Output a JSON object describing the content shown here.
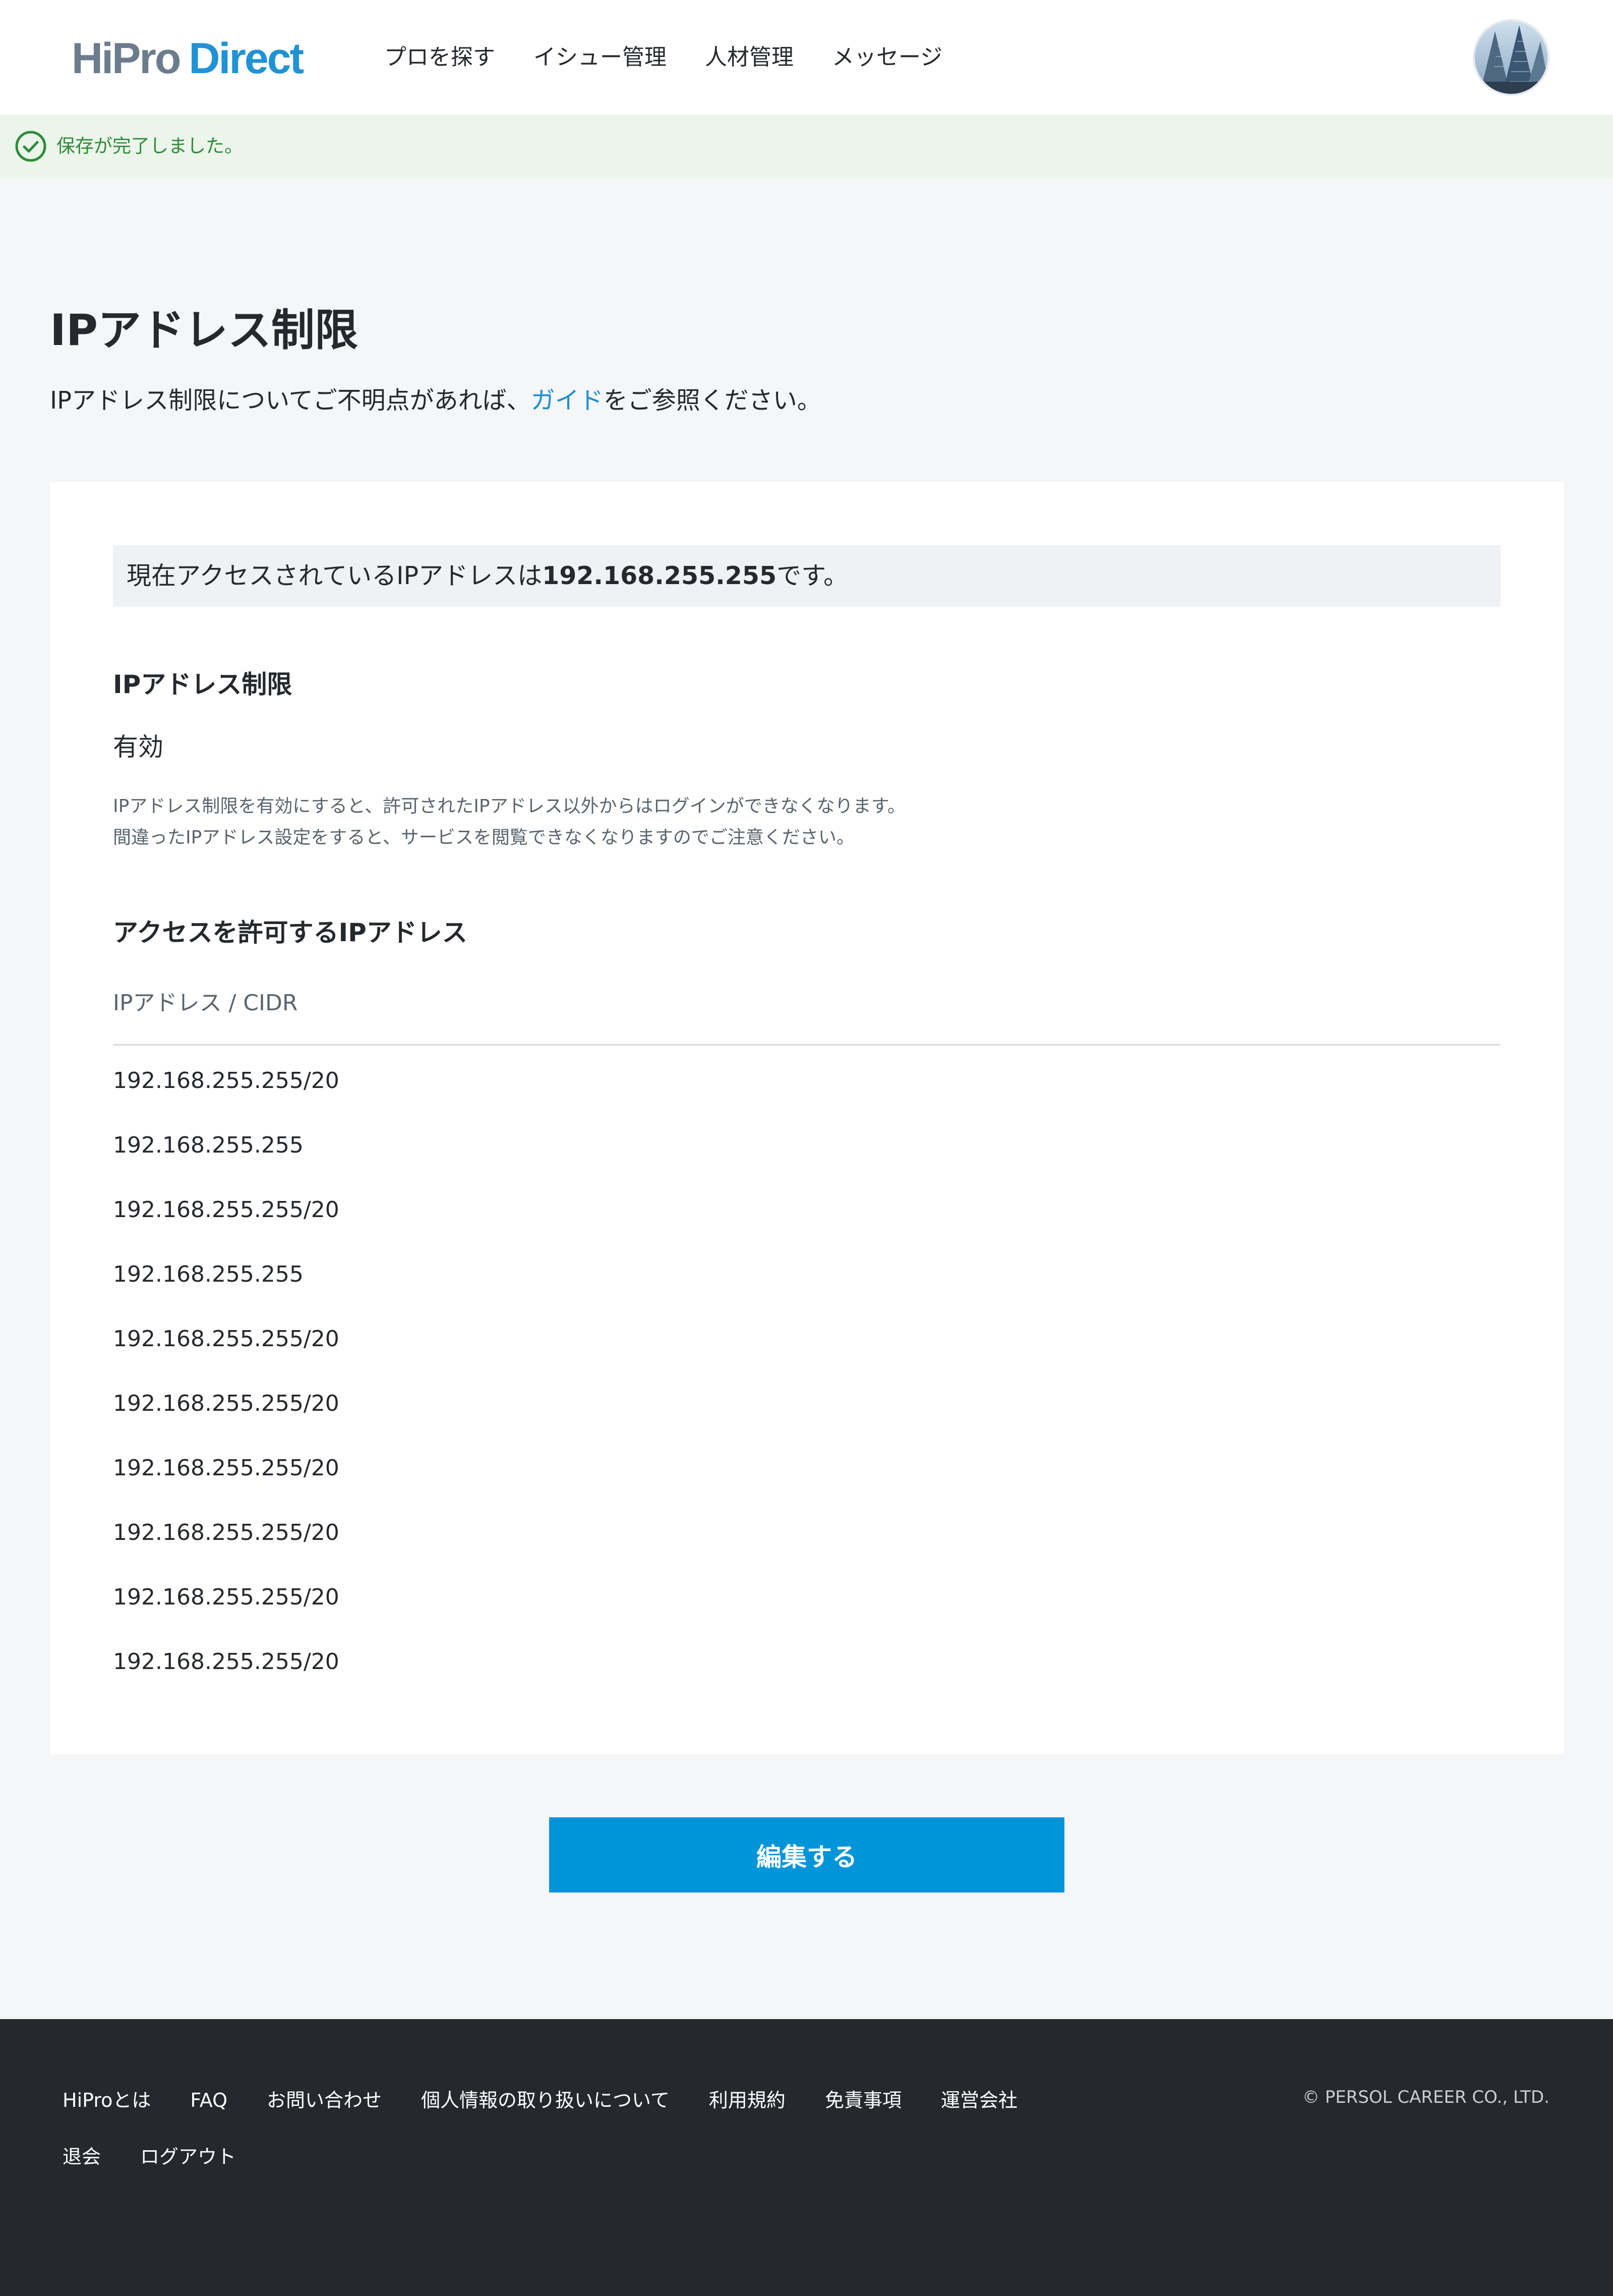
{
  "header": {
    "logo": {
      "part1": "HiPro",
      "part2": "Direct"
    },
    "nav": [
      "プロを探す",
      "イシュー管理",
      "人材管理",
      "メッセージ"
    ]
  },
  "alert": {
    "message": "保存が完了しました。"
  },
  "page": {
    "title": "IPアドレス制限",
    "desc_before": "IPアドレス制限についてご不明点があれば、",
    "desc_link": "ガイド",
    "desc_after": "をご参照ください。"
  },
  "current_ip": {
    "prefix": "現在アクセスされているIPアドレスは",
    "ip": "192.168.255.255",
    "suffix": "です。"
  },
  "restriction": {
    "heading": "IPアドレス制限",
    "value": "有効",
    "notes": [
      "IPアドレス制限を有効にすると、許可されたIPアドレス以外からはログインができなくなります。",
      "間違ったIPアドレス設定をすると、サービスを閲覧できなくなりますのでご注意ください。"
    ]
  },
  "allowed": {
    "heading": "アクセスを許可するIPアドレス",
    "column": "IPアドレス / CIDR",
    "items": [
      "192.168.255.255/20",
      "192.168.255.255",
      "192.168.255.255/20",
      "192.168.255.255",
      "192.168.255.255/20",
      "192.168.255.255/20",
      "192.168.255.255/20",
      "192.168.255.255/20",
      "192.168.255.255/20",
      "192.168.255.255/20"
    ]
  },
  "edit_button": "編集する",
  "footer": {
    "links_row1": [
      "HiProとは",
      "FAQ",
      "お問い合わせ",
      "個人情報の取り扱いについて",
      "利用規約",
      "免責事項",
      "運営会社"
    ],
    "links_row2": [
      "退会",
      "ログアウト"
    ],
    "copyright": "© PERSOL CAREER CO., LTD."
  },
  "colors": {
    "accent": "#0095d9",
    "link": "#1f8fcf",
    "success_bg": "#ebf5ea",
    "success_text": "#2e8b3a",
    "footer_bg": "#25292d"
  },
  "icons": {
    "alert": "check-circle-icon",
    "avatar": "user-avatar"
  }
}
